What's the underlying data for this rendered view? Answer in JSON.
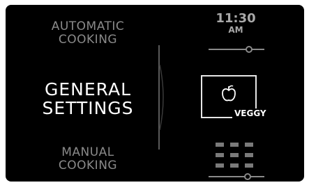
{
  "menu": {
    "automatic": [
      "AUTOMATIC",
      "COOKING"
    ],
    "general": [
      "GENERAL",
      "SETTINGS"
    ],
    "manual": [
      "MANUAL",
      "COOKING"
    ]
  },
  "clock": {
    "time": "11:30",
    "ampm": "AM"
  },
  "program_tile": {
    "label": "VEGGY",
    "icon": "apple-icon"
  },
  "icons": {
    "keypad": "keypad-icon",
    "slider": "slider-icon"
  },
  "colors": {
    "background": "#000000",
    "selected_text": "#ffffff",
    "inactive_text": "#8a8a8a"
  }
}
